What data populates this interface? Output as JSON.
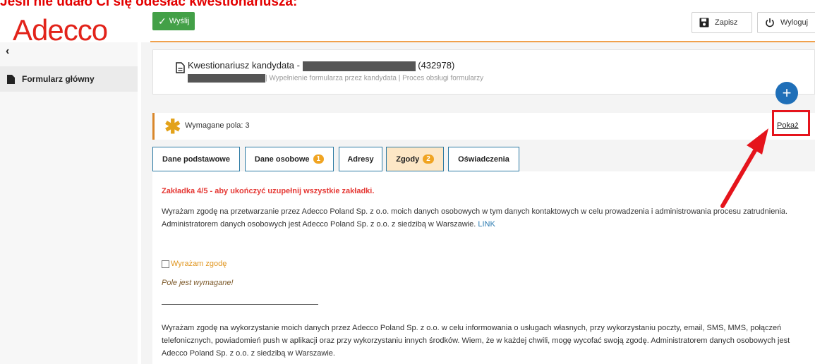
{
  "annotation": {
    "banner": "Jeśli nie udało Ci się odesłać kwestionariusza:"
  },
  "brand": {
    "logo": "Adecco",
    "logo_color": "#e2231a"
  },
  "toolbar": {
    "send_label": "Wyślij",
    "save_label": "Zapisz",
    "logout_label": "Wyloguj"
  },
  "sidebar": {
    "items": [
      {
        "label": "Formularz główny"
      }
    ]
  },
  "header": {
    "title_prefix": "Kwestionariusz kandydata -",
    "title_suffix": "(432978)",
    "subtitle": "| Wypełnienie formularza przez kandydata | Proces obsługi formularzy"
  },
  "required": {
    "text": "Wymagane pola: 3",
    "show_label": "Pokaż"
  },
  "tabs": [
    {
      "label": "Dane podstawowe",
      "badge": ""
    },
    {
      "label": "Dane osobowe",
      "badge": "1"
    },
    {
      "label": "Adresy",
      "badge": ""
    },
    {
      "label": "Zgody",
      "badge": "2"
    },
    {
      "label": "Oświadczenia",
      "badge": ""
    }
  ],
  "content": {
    "warning": "Zakładka 4/5 - aby ukończyć uzupełnij wszystkie zakładki.",
    "consent1_text": "Wyrażam zgodę na przetwarzanie przez Adecco Poland Sp. z o.o. moich danych osobowych w tym danych kontaktowych w celu prowadzenia i administrowania procesu zatrudnienia. Administratorem danych osobowych jest Adecco Poland Sp. z o.o. z siedzibą w Warszawie.",
    "consent1_link": "LINK",
    "checkbox_label": "Wyrażam zgodę",
    "required_msg": "Pole jest wymagane!",
    "consent2_text": "Wyrażam zgodę na wykorzystanie moich danych przez Adecco Poland Sp. z o.o. w celu informowania o usługach własnych, przy wykorzystaniu poczty, email, SMS, MMS, połączeń telefonicznych, powiadomień push w aplikacji oraz przy wykorzystaniu innych środków. Wiem, że w każdej chwili, mogę wycofać swoją zgodę. Administratorem danych osobowych jest Adecco Poland Sp. z o.o. z siedzibą w Warszawie."
  },
  "colors": {
    "accent_orange": "#f0a04b",
    "send_green": "#43a047",
    "plus_blue": "#1f6fb8",
    "annotation_red": "#e5141c"
  }
}
